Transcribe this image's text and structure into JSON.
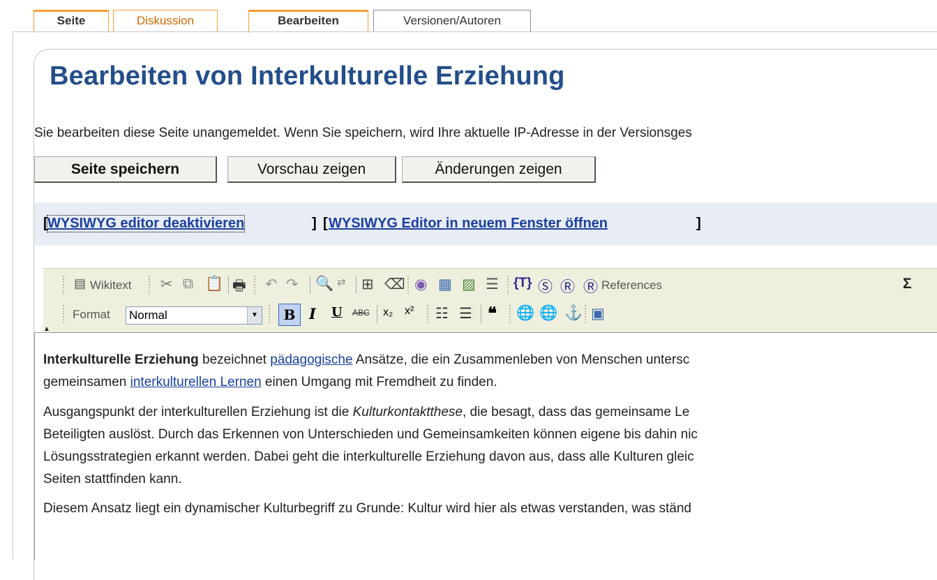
{
  "tabs": [
    {
      "label": "Seite",
      "state": "selected"
    },
    {
      "label": "Diskussion",
      "state": "normal"
    },
    {
      "label": "Bearbeiten",
      "state": "selected"
    },
    {
      "label": "Versionen/Autoren",
      "state": "normal"
    }
  ],
  "page_title": "Bearbeiten von Interkulturelle Erziehung",
  "notice": "Sie bearbeiten diese Seite unangemeldet. Wenn Sie speichern, wird Ihre aktuelle IP-Adresse in der Versionsges",
  "buttons": {
    "save": "Seite speichern",
    "preview": "Vorschau zeigen",
    "diff": "Änderungen zeigen"
  },
  "wysiwyg": {
    "deactivate": "WYSIWYG editor deaktivieren",
    "new_window": "WYSIWYG Editor in neuem Fenster öffnen",
    "bracket_open": "[",
    "bracket_close": "]"
  },
  "toolbar": {
    "wikitext_label": "Wikitext",
    "references_label": "References",
    "format_label": "Format",
    "format_value": "Normal",
    "sigma": "Σ",
    "icons_row1": [
      "source-icon",
      "cut-icon",
      "copy-icon",
      "paste-icon",
      "print-icon",
      "undo-icon",
      "redo-icon",
      "find-icon",
      "replace-icon",
      "select-all-icon",
      "remove-format-icon",
      "image-icon",
      "table-icon",
      "gallery-icon",
      "hr-icon",
      "template-icon",
      "special-s-icon",
      "ref-icon",
      "references-icon",
      "sigma-icon"
    ],
    "icons_row2": [
      "bold-icon",
      "italic-icon",
      "underline-icon",
      "strike-icon",
      "subscript-icon",
      "superscript-icon",
      "ordered-list-icon",
      "unordered-list-icon",
      "blockquote-icon",
      "link-icon",
      "unlink-icon",
      "anchor-icon",
      "maximize-icon"
    ]
  },
  "editor": {
    "p1_bold": "Interkulturelle Erziehung",
    "p1_text1": " bezeichnet ",
    "p1_link1": "pädagogische",
    "p1_text2": " Ansätze, die ein Zusammenleben von Menschen untersc",
    "p1_line2_a": "gemeinsamen ",
    "p1_link2": "interkulturellen Lernen",
    "p1_line2_b": " einen Umgang mit Fremdheit zu finden.",
    "p2_line1_a": "Ausgangspunkt der interkulturellen Erziehung ist die ",
    "p2_italic": "Kulturkontaktthese",
    "p2_line1_b": ", die besagt, dass das gemeinsame Le",
    "p2_line2": "Beteiligten auslöst. Durch das Erkennen von Unterschieden und Gemeinsamkeiten können eigene bis dahin nic",
    "p2_line3": "Lösungsstrategien erkannt werden. Dabei geht die interkulturelle Erziehung davon aus, dass alle Kulturen gleic",
    "p2_line4": "Seiten stattfinden kann.",
    "p3_line1": "Diesem Ansatz liegt ein dynamischer Kulturbegriff zu Grunde: Kultur wird hier als etwas verstanden, was ständ"
  }
}
